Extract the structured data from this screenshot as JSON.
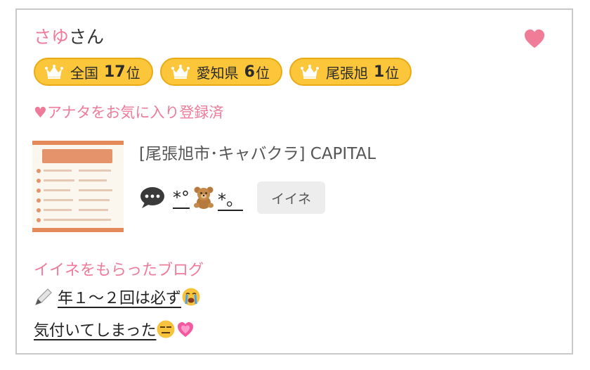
{
  "profile": {
    "name": "さゆ",
    "suffix": "さん"
  },
  "rankings": [
    {
      "area": "全国",
      "rank": "17",
      "unit": "位"
    },
    {
      "area": "愛知県",
      "rank": "6",
      "unit": "位"
    },
    {
      "area": "尾張旭",
      "rank": "1",
      "unit": "位"
    }
  ],
  "favorite_status": "♥アナタをお気に入り登録済",
  "shop": {
    "label": "[尾張旭市･キャバクラ]  CAPITAL"
  },
  "comment": {
    "text_before": "*°",
    "text_after": "*。"
  },
  "iine_button": "イイネ",
  "blog_section": {
    "heading": "イイネをもらったブログ",
    "posts": [
      {
        "title": "年１～２回は必ず"
      },
      {
        "title": "気付いてしまった"
      }
    ]
  },
  "colors": {
    "accent_pink": "#ee7b9a",
    "badge_yellow": "#fcc63a",
    "heart": "#f17c98"
  },
  "icons": [
    "heart-icon",
    "crown-icon",
    "chat-bubble-icon",
    "bear-emoji",
    "pencil-emoji",
    "crying-emoji",
    "expressionless-emoji",
    "growing-heart-emoji"
  ]
}
